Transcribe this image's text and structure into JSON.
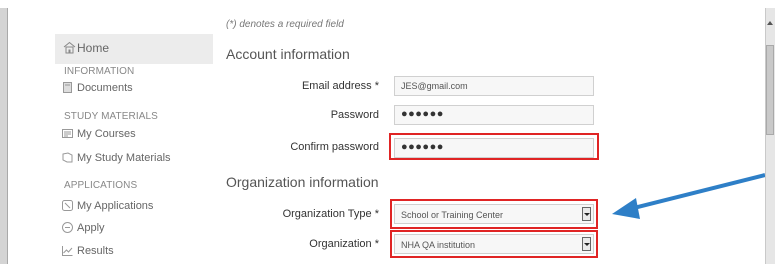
{
  "form": {
    "required_note": "(*) denotes a required field",
    "account_section_title": "Account information",
    "org_section_title": "Organization information",
    "email": {
      "label": "Email address *",
      "value": "JES@gmail.com"
    },
    "password": {
      "label": "Password",
      "value": "●●●●●●"
    },
    "confirm_password": {
      "label": "Confirm password",
      "value": "●●●●●●"
    },
    "organization_type": {
      "label": "Organization Type *",
      "value": "School or Training Center"
    },
    "organization": {
      "label": "Organization *",
      "value": "NHA QA institution"
    }
  },
  "sidebar": {
    "home": "Home",
    "sections": [
      {
        "title": "INFORMATION",
        "items": [
          {
            "label": "Documents",
            "icon": "document-icon"
          }
        ]
      },
      {
        "title": "STUDY MATERIALS",
        "items": [
          {
            "label": "My Courses",
            "icon": "courses-icon"
          },
          {
            "label": "My Study Materials",
            "icon": "study-materials-icon"
          }
        ]
      },
      {
        "title": "APPLICATIONS",
        "items": [
          {
            "label": "My Applications",
            "icon": "applications-icon"
          },
          {
            "label": "Apply",
            "icon": "apply-icon"
          },
          {
            "label": "Results",
            "icon": "results-icon"
          }
        ]
      }
    ]
  },
  "annotation": {
    "highlight_color": "#e02424",
    "arrow_color": "#2e7fc7"
  }
}
